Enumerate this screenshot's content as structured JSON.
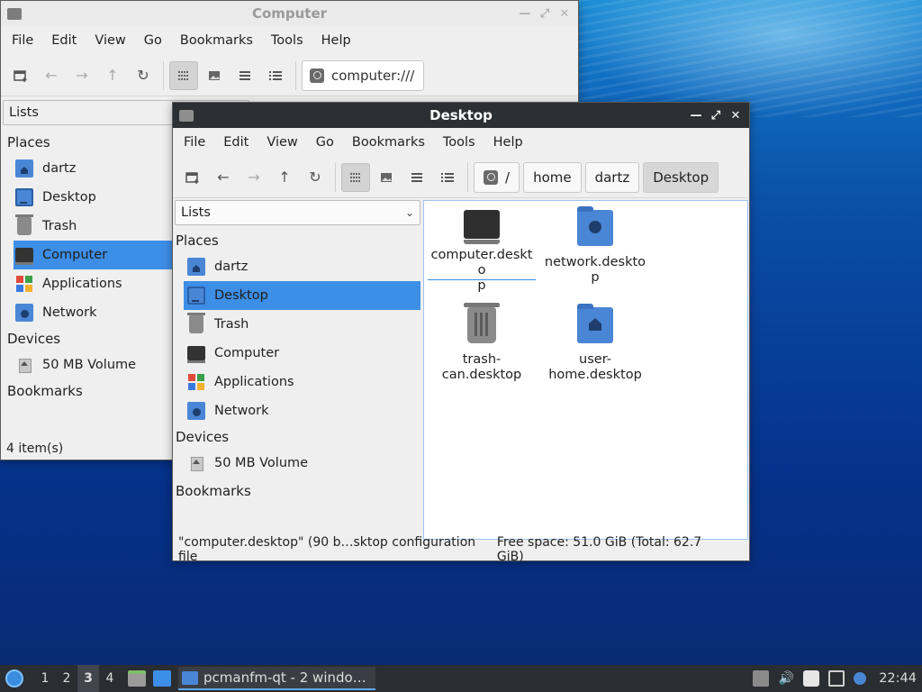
{
  "back_window": {
    "title": "Computer",
    "menu": [
      "File",
      "Edit",
      "View",
      "Go",
      "Bookmarks",
      "Tools",
      "Help"
    ],
    "path": "computer:///",
    "lists_label": "Lists",
    "sections": {
      "places": "Places",
      "devices": "Devices",
      "bookmarks": "Bookmarks"
    },
    "places": [
      "dartz",
      "Desktop",
      "Trash",
      "Computer",
      "Applications",
      "Network"
    ],
    "selected_place": "Computer",
    "devices": [
      "50 MB Volume"
    ],
    "status": "4 item(s)"
  },
  "front_window": {
    "title": "Desktop",
    "menu": [
      "File",
      "Edit",
      "View",
      "Go",
      "Bookmarks",
      "Tools",
      "Help"
    ],
    "breadcrumbs": [
      "/",
      "home",
      "dartz",
      "Desktop"
    ],
    "lists_label": "Lists",
    "sections": {
      "places": "Places",
      "devices": "Devices",
      "bookmarks": "Bookmarks"
    },
    "places": [
      "dartz",
      "Desktop",
      "Trash",
      "Computer",
      "Applications",
      "Network"
    ],
    "selected_place": "Desktop",
    "devices": [
      "50 MB Volume"
    ],
    "files": [
      {
        "label": "computer.deskto\np",
        "icon": "computer-icon"
      },
      {
        "label": "network.desktop",
        "icon": "network-folder-icon"
      },
      {
        "label": "trash-\ncan.desktop",
        "icon": "trash-icon"
      },
      {
        "label": "user-\nhome.desktop",
        "icon": "home-folder-icon"
      }
    ],
    "status_left": "\"computer.desktop\" (90 b…sktop configuration file",
    "status_right": "Free space: 51.0 GiB (Total: 62.7 GiB)"
  },
  "taskbar": {
    "workspaces": [
      "1",
      "2",
      "3",
      "4"
    ],
    "active_workspace": "3",
    "task_label": "pcmanfm-qt - 2 windo…",
    "clock": "22:44"
  },
  "colors": {
    "selection": "#3d8ee6",
    "titlebar_active": "#2c2f33",
    "folder_blue": "#4a86d6"
  }
}
